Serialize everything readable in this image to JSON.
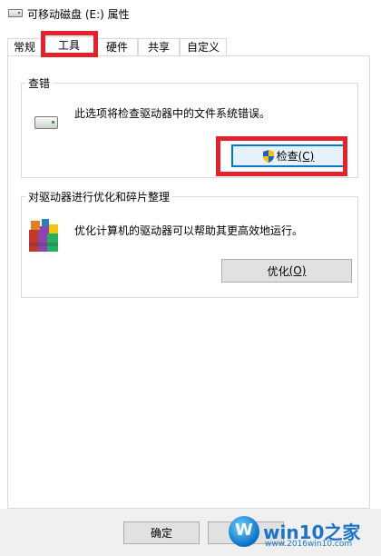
{
  "window": {
    "title": "可移动磁盘 (E:) 属性"
  },
  "tabs": [
    {
      "label": "常规"
    },
    {
      "label": "工具"
    },
    {
      "label": "硬件"
    },
    {
      "label": "共享"
    },
    {
      "label": "自定义"
    }
  ],
  "active_tab": "工具",
  "error_check": {
    "title": "查错",
    "description": "此选项将检查驱动器中的文件系统错误。",
    "button_label": "检查",
    "button_key": "(C)"
  },
  "optimize": {
    "title": "对驱动器进行优化和碎片整理",
    "description": "优化计算机的驱动器可以帮助其更高效地运行。",
    "button_label": "优化",
    "button_key": "(O)"
  },
  "footer": {
    "ok_label": "确定"
  },
  "watermark": {
    "brand": "win10之家",
    "url": "www.2016win10.com"
  },
  "colors": {
    "highlight": "#e4222b",
    "focus_border": "#0078d7",
    "panel_bg": "#ffffff",
    "footer_bg": "#f0f0f0"
  },
  "icons": {
    "title": "drive-icon",
    "error_check": "drive-icon",
    "error_button": "uac-shield-icon",
    "optimize": "defrag-icon"
  }
}
